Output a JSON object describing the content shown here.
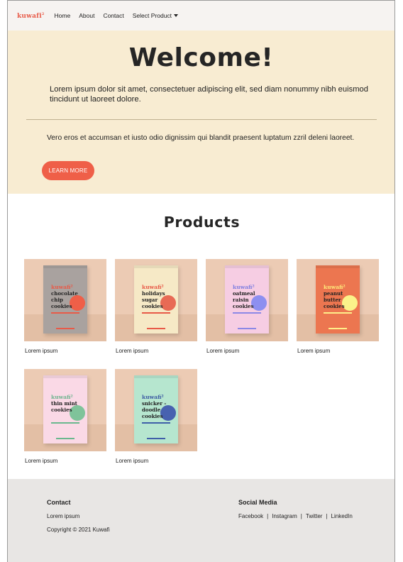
{
  "nav": {
    "logo": "kuwafi",
    "logo_sup": "2",
    "links": [
      "Home",
      "About",
      "Contact"
    ],
    "dropdown_label": "Select Product"
  },
  "hero": {
    "title": "Welcome!",
    "paragraph1": "Lorem ipsum dolor sit amet, consectetuer adipiscing elit, sed diam nonummy nibh euismod tincidunt ut laoreet dolore.",
    "paragraph2": "Vero eros et accumsan et iusto odio dignissim qui blandit praesent luptatum zzril deleni laoreet.",
    "button": "LEARN MORE"
  },
  "products": {
    "title": "Products",
    "items": [
      {
        "label": "Lorem ipsum",
        "brand": "kuwafi²",
        "name": "chocolate chip cookies",
        "box": "#a9a29f",
        "accent": "#e85a48",
        "brand_color": "#e85a48",
        "dot": "#ef5f48"
      },
      {
        "label": "Lorem ipsum",
        "brand": "kuwafi²",
        "name": "holidays sugar cookies",
        "box": "#f6e9c6",
        "accent": "#e85a48",
        "brand_color": "#e85a48",
        "dot": "#e86a55"
      },
      {
        "label": "Lorem ipsum",
        "brand": "kuwafi²",
        "name": "oatmeal raisin cookies",
        "box": "#f6cde3",
        "accent": "#8c88e6",
        "brand_color": "#7f7ee0",
        "dot": "#8d8ff0"
      },
      {
        "label": "Lorem ipsum",
        "brand": "kuwafi²",
        "name": "peanut butter cookies",
        "box": "#ec7650",
        "accent": "#ffef8a",
        "brand_color": "#ffe97a",
        "dot": "#fbf38a"
      },
      {
        "label": "Lorem ipsum",
        "brand": "kuwafi²",
        "name": "thin mint cookies",
        "box": "#fad9e6",
        "accent": "#6ab88e",
        "brand_color": "#6fb48f",
        "dot": "#7fc39a"
      },
      {
        "label": "Lorem ipsum",
        "brand": "kuwafi²",
        "name": "snicker -doodle cookies",
        "box": "#b6e6cf",
        "accent": "#3f5fa8",
        "brand_color": "#3d5ca3",
        "dot": "#4862b0"
      }
    ]
  },
  "footer": {
    "contact_heading": "Contact",
    "contact_text": "Lorem ipsum",
    "copyright": "Copyright © 2021 Kuwafi",
    "social_heading": "Social Media",
    "social_links": [
      "Facebook",
      "Instagram",
      "Twitter",
      "LinkedIn"
    ]
  }
}
